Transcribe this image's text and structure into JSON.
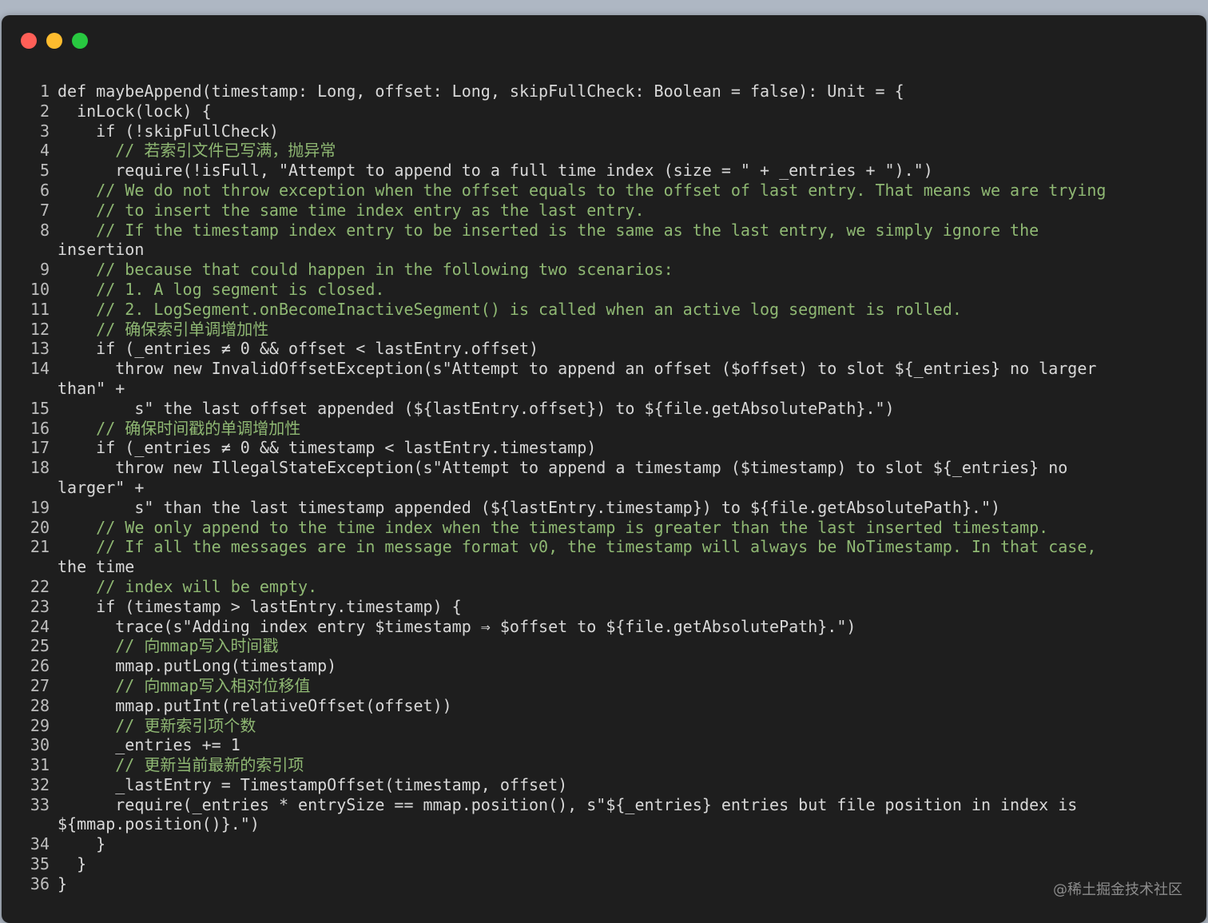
{
  "window": {
    "controls": {
      "close": "close-button",
      "minimize": "minimize-button",
      "zoom": "zoom-button"
    }
  },
  "code": {
    "lines": [
      {
        "n": "1",
        "t": "def maybeAppend(timestamp: Long, offset: Long, skipFullCheck: Boolean = false): Unit = {"
      },
      {
        "n": "2",
        "t": "  inLock(lock) {"
      },
      {
        "n": "3",
        "t": "    if (!skipFullCheck)"
      },
      {
        "n": "4",
        "t": "      // 若索引文件已写满，抛异常"
      },
      {
        "n": "5",
        "t": "      require(!isFull, \"Attempt to append to a full time index (size = \" + _entries + \").\")"
      },
      {
        "n": "6",
        "t": "    // We do not throw exception when the offset equals to the offset of last entry. That means we are trying"
      },
      {
        "n": "7",
        "t": "    // to insert the same time index entry as the last entry."
      },
      {
        "n": "8",
        "t": "    // If the timestamp index entry to be inserted is the same as the last entry, we simply ignore the"
      },
      {
        "n": "",
        "t": "insertion"
      },
      {
        "n": "9",
        "t": "    // because that could happen in the following two scenarios:"
      },
      {
        "n": "10",
        "t": "    // 1. A log segment is closed."
      },
      {
        "n": "11",
        "t": "    // 2. LogSegment.onBecomeInactiveSegment() is called when an active log segment is rolled."
      },
      {
        "n": "12",
        "t": "    // 确保索引单调增加性"
      },
      {
        "n": "13",
        "t": "    if (_entries ≠ 0 && offset < lastEntry.offset)"
      },
      {
        "n": "14",
        "t": "      throw new InvalidOffsetException(s\"Attempt to append an offset ($offset) to slot ${_entries} no larger"
      },
      {
        "n": "",
        "t": "than\" +"
      },
      {
        "n": "15",
        "t": "        s\" the last offset appended (${lastEntry.offset}) to ${file.getAbsolutePath}.\")"
      },
      {
        "n": "16",
        "t": "    // 确保时间戳的单调增加性"
      },
      {
        "n": "17",
        "t": "    if (_entries ≠ 0 && timestamp < lastEntry.timestamp)"
      },
      {
        "n": "18",
        "t": "      throw new IllegalStateException(s\"Attempt to append a timestamp ($timestamp) to slot ${_entries} no"
      },
      {
        "n": "",
        "t": "larger\" +"
      },
      {
        "n": "19",
        "t": "        s\" than the last timestamp appended (${lastEntry.timestamp}) to ${file.getAbsolutePath}.\")"
      },
      {
        "n": "20",
        "t": "    // We only append to the time index when the timestamp is greater than the last inserted timestamp."
      },
      {
        "n": "21",
        "t": "    // If all the messages are in message format v0, the timestamp will always be NoTimestamp. In that case,"
      },
      {
        "n": "",
        "t": "the time"
      },
      {
        "n": "22",
        "t": "    // index will be empty."
      },
      {
        "n": "23",
        "t": "    if (timestamp > lastEntry.timestamp) {"
      },
      {
        "n": "24",
        "t": "      trace(s\"Adding index entry $timestamp ⇒ $offset to ${file.getAbsolutePath}.\")"
      },
      {
        "n": "25",
        "t": "      // 向mmap写入时间戳"
      },
      {
        "n": "26",
        "t": "      mmap.putLong(timestamp)"
      },
      {
        "n": "27",
        "t": "      // 向mmap写入相对位移值"
      },
      {
        "n": "28",
        "t": "      mmap.putInt(relativeOffset(offset))"
      },
      {
        "n": "29",
        "t": "      // 更新索引项个数"
      },
      {
        "n": "30",
        "t": "      _entries += 1"
      },
      {
        "n": "31",
        "t": "      // 更新当前最新的索引项"
      },
      {
        "n": "32",
        "t": "      _lastEntry = TimestampOffset(timestamp, offset)"
      },
      {
        "n": "33",
        "t": "      require(_entries * entrySize == mmap.position(), s\"${_entries} entries but file position in index is"
      },
      {
        "n": "",
        "t": "${mmap.position()}.\")"
      },
      {
        "n": "34",
        "t": "    }"
      },
      {
        "n": "35",
        "t": "  }"
      },
      {
        "n": "36",
        "t": "}"
      }
    ]
  },
  "watermark": "@稀土掘金技术社区"
}
